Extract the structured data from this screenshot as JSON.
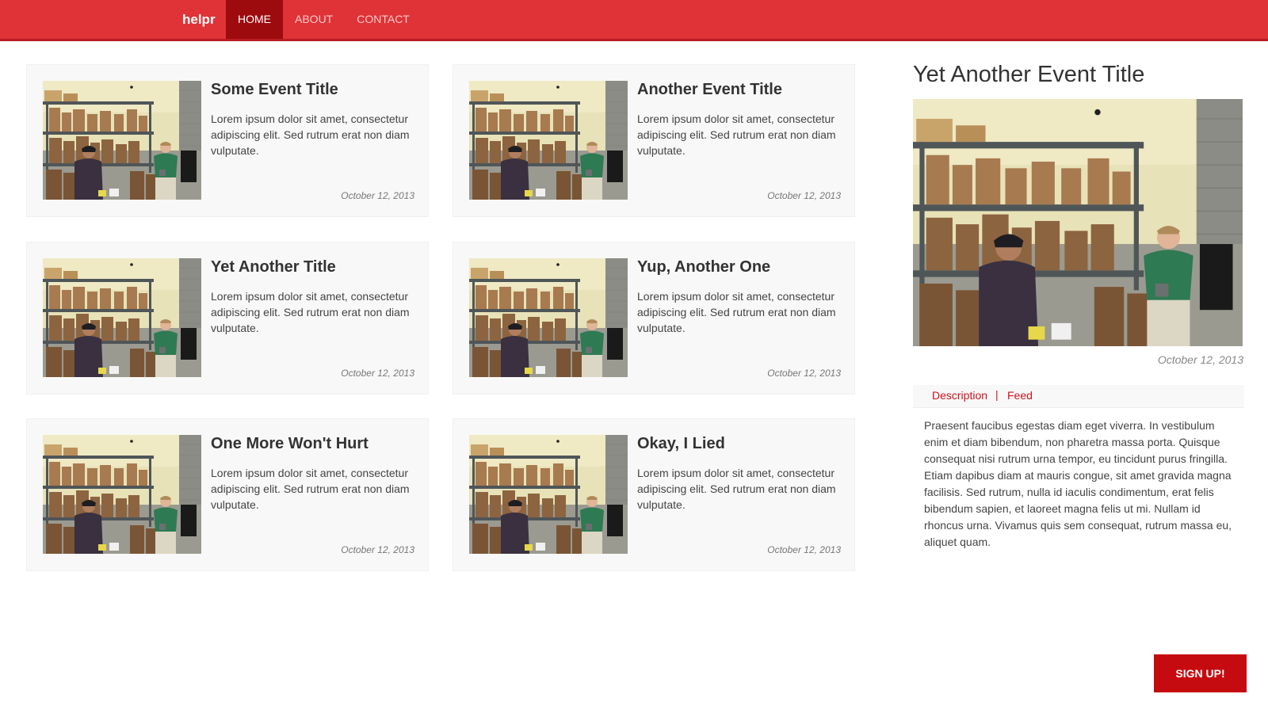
{
  "nav": {
    "brand": "helpr",
    "items": [
      {
        "label": "HOME",
        "active": true
      },
      {
        "label": "ABOUT",
        "active": false
      },
      {
        "label": "CONTACT",
        "active": false
      }
    ]
  },
  "events": [
    {
      "title": "Some Event Title",
      "body": "Lorem ipsum dolor sit amet, consectetur adipiscing elit. Sed rutrum erat non diam vulputate.",
      "date": "October 12, 2013"
    },
    {
      "title": "Another Event Title",
      "body": "Lorem ipsum dolor sit amet, consectetur adipiscing elit. Sed rutrum erat non diam vulputate.",
      "date": "October 12, 2013"
    },
    {
      "title": "Yet Another Title",
      "body": "Lorem ipsum dolor sit amet, consectetur adipiscing elit. Sed rutrum erat non diam vulputate.",
      "date": "October 12, 2013"
    },
    {
      "title": "Yup, Another One",
      "body": "Lorem ipsum dolor sit amet, consectetur adipiscing elit. Sed rutrum erat non diam vulputate.",
      "date": "October 12, 2013"
    },
    {
      "title": "One More Won't Hurt",
      "body": "Lorem ipsum dolor sit amet, consectetur adipiscing elit. Sed rutrum erat non diam vulputate.",
      "date": "October 12, 2013"
    },
    {
      "title": "Okay, I Lied",
      "body": "Lorem ipsum dolor sit amet, consectetur adipiscing elit. Sed rutrum erat non diam vulputate.",
      "date": "October 12, 2013"
    }
  ],
  "detail": {
    "title": "Yet Another Event Title",
    "date": "October 12, 2013",
    "tabs": [
      "Description",
      "Feed"
    ],
    "tab_separator": "|",
    "description": "Praesent faucibus egestas diam eget viverra. In vestibulum enim et diam bibendum, non pharetra massa porta. Quisque consequat nisi rutrum urna tempor, eu tincidunt purus fringilla. Etiam dapibus diam at mauris congue, sit amet gravida magna facilisis. Sed rutrum, nulla id iaculis condimentum, erat felis bibendum sapien, et laoreet magna felis ut mi. Nullam id rhoncus urna. Vivamus quis sem consequat, rutrum massa eu, aliquet quam."
  },
  "signup_label": "SIGN UP!",
  "colors": {
    "brand_red": "#df3337",
    "active_nav": "#9e0b0f",
    "link_red": "#c9151c",
    "button_red": "#c60b10"
  }
}
